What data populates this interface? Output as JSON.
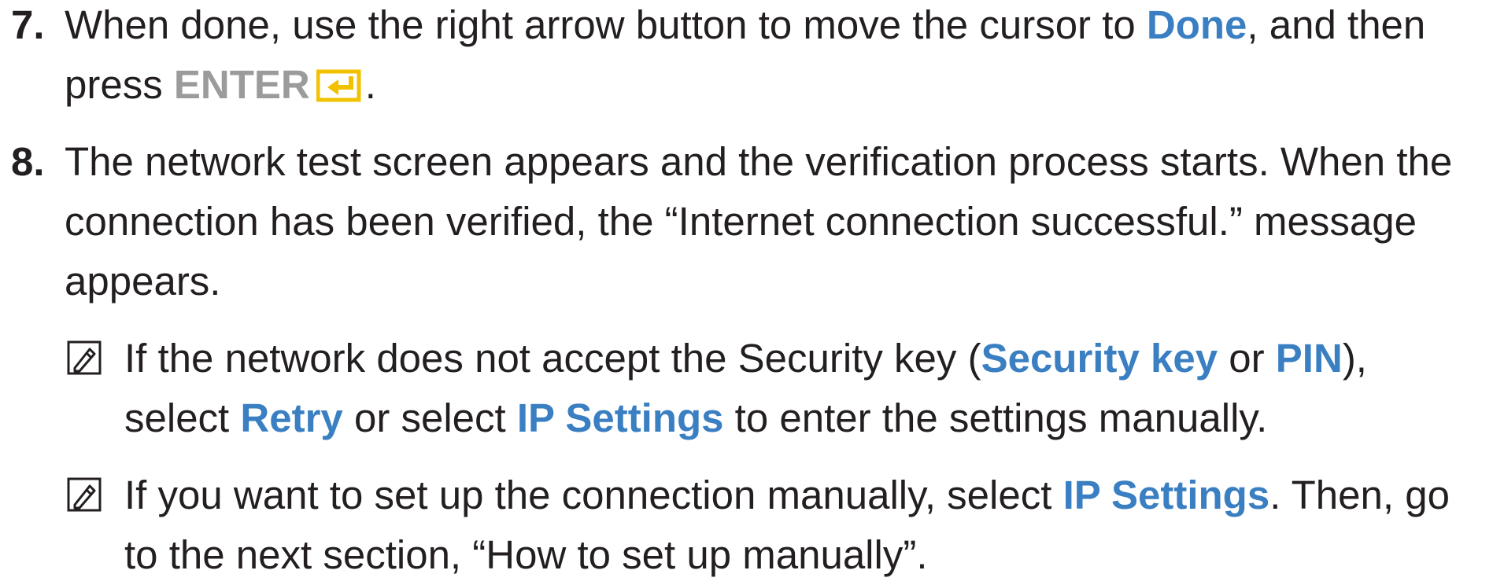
{
  "colors": {
    "text": "#231f20",
    "highlight": "#3a7fc2",
    "enter_label": "#9b9b9b",
    "enter_icon": "#f2c200"
  },
  "steps": [
    {
      "number": "7.",
      "t1": "When done, use the right arrow button to move the cursor to ",
      "done": "Done",
      "t2": ", and then press ",
      "enter": "ENTER",
      "enter_icon": "enter-icon",
      "t3": "."
    },
    {
      "number": "8.",
      "text": "The network test screen appears and the verification process starts. When the connection has been verified, the “Internet connection successful.” message appears."
    }
  ],
  "notes": [
    {
      "icon": "note-icon",
      "t1": "If the network does not accept the Security key (",
      "h1": "Security key",
      "t2": " or ",
      "h2": "PIN",
      "t3": "), select ",
      "h3": "Retry",
      "t4": " or select ",
      "h4": "IP Settings",
      "t5": " to enter the settings manually."
    },
    {
      "icon": "note-icon",
      "t1": "If you want to set up the connection manually, select ",
      "h1": "IP Settings",
      "t2": ". Then, go to the next section, “How to set up manually”."
    }
  ]
}
